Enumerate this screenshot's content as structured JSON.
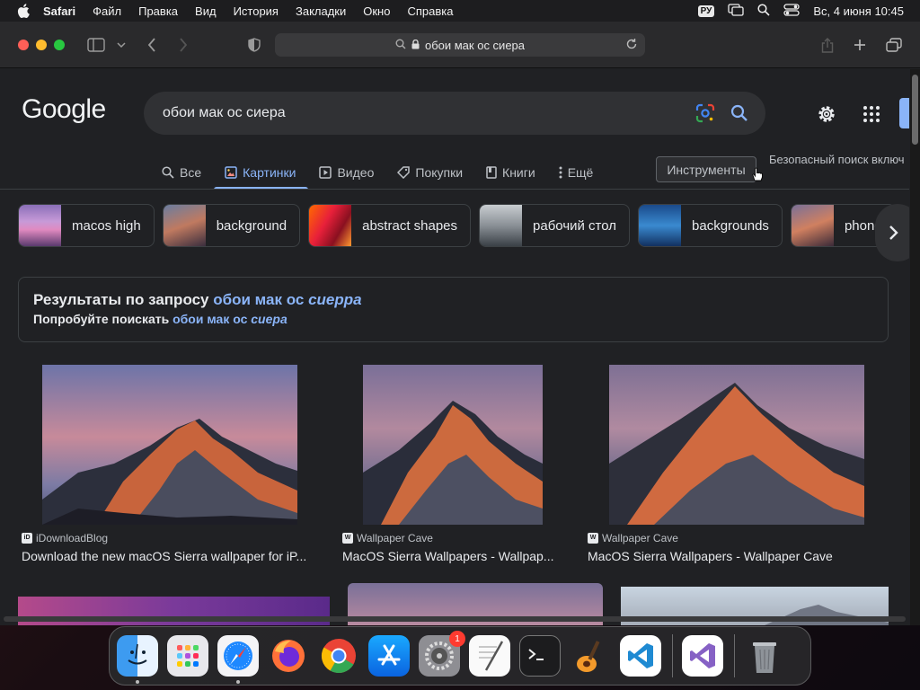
{
  "menubar": {
    "app": "Safari",
    "items": [
      "Файл",
      "Правка",
      "Вид",
      "История",
      "Закладки",
      "Окно",
      "Справка"
    ],
    "keyboard": "РУ",
    "datetime": "Вс, 4 июня  10:45"
  },
  "browser": {
    "address": "обои мак ос сиера"
  },
  "google": {
    "logo": "Google",
    "query": "обои мак ос сиера",
    "tabs": [
      {
        "label": "Все",
        "icon": "search-icon"
      },
      {
        "label": "Картинки",
        "icon": "image-icon"
      },
      {
        "label": "Видео",
        "icon": "play-icon"
      },
      {
        "label": "Покупки",
        "icon": "tag-icon"
      },
      {
        "label": "Книги",
        "icon": "book-icon"
      },
      {
        "label": "Ещё",
        "icon": "more-icon"
      }
    ],
    "tools_label": "Инструменты",
    "safesearch": "Безопасный поиск включ",
    "chips": [
      "macos high",
      "background",
      "abstract shapes",
      "рабочий стол",
      "backgrounds",
      "phone"
    ],
    "didyoumean": {
      "line1_prefix": "Результаты по запросу ",
      "line1_link_plain": "обои мак ос ",
      "line1_link_emph": "сиерра",
      "line2_prefix": "Попробуйте поискать ",
      "line2_link_plain": "обои мак ос ",
      "line2_link_emph": "сиера"
    },
    "results": [
      {
        "source": "iDownloadBlog",
        "title": "Download the new macOS Sierra wallpaper for iP..."
      },
      {
        "source": "Wallpaper Cave",
        "title": "MacOS Sierra Wallpapers - Wallpap..."
      },
      {
        "source": "Wallpaper Cave",
        "title": "MacOS Sierra Wallpapers - Wallpaper Cave"
      }
    ]
  },
  "dock": {
    "apps": [
      "finder-icon",
      "launchpad-icon",
      "safari-icon",
      "firefox-icon",
      "chrome-icon",
      "app-store-icon",
      "system-settings-icon",
      "textedit-icon",
      "terminal-icon",
      "garageband-icon",
      "vscode-icon",
      "visual-studio-icon",
      "trash-icon"
    ],
    "settings_badge": "1"
  }
}
